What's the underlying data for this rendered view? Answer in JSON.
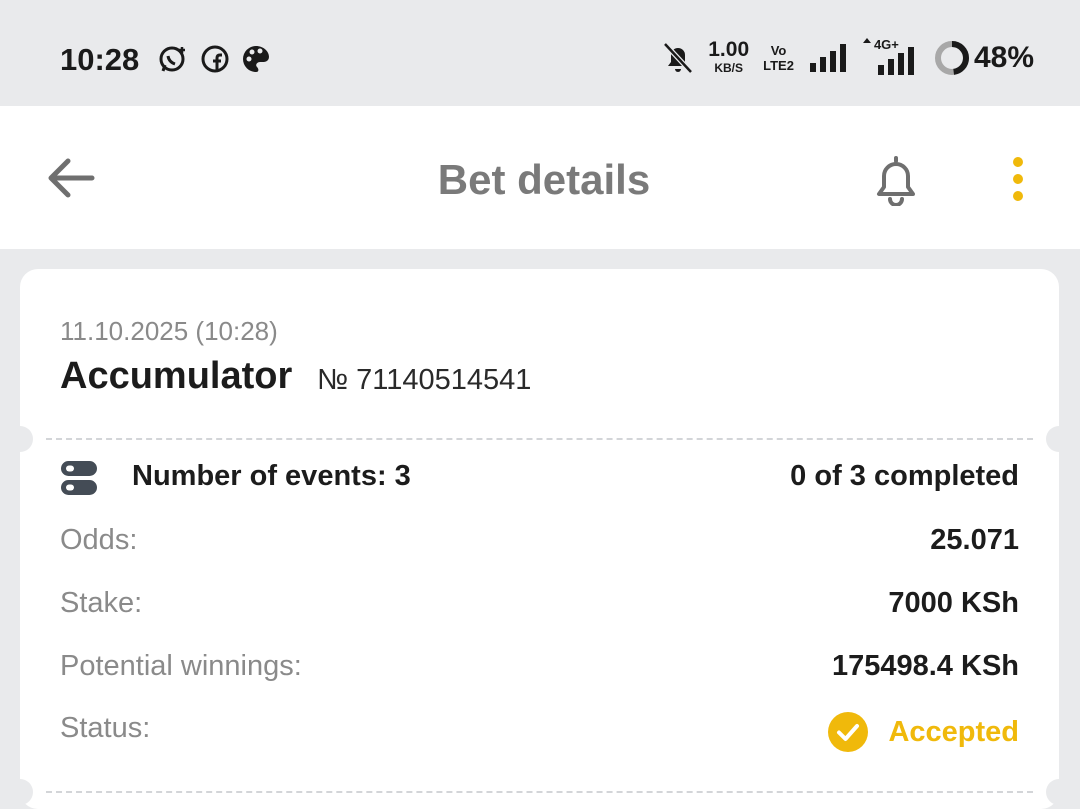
{
  "status_bar": {
    "time": "10:28",
    "apps": [
      "whatsapp-icon",
      "facebook-icon",
      "palette-icon"
    ],
    "net_speed_value": "1.00",
    "net_speed_unit": "KB/S",
    "volte_top": "Vo",
    "volte_bottom": "LTE2",
    "network_type": "4G+",
    "battery_percent": "48%",
    "battery_level": 0.48
  },
  "app_bar": {
    "title": "Bet details"
  },
  "bet": {
    "datetime": "11.10.2025 (10:28)",
    "type": "Accumulator",
    "number": "№ 71140514541",
    "events_label": "Number of events: 3",
    "events_progress": "0 of 3 completed",
    "odds_label": "Odds:",
    "odds_value": "25.071",
    "stake_label": "Stake:",
    "stake_value": "7000 KSh",
    "winnings_label": "Potential winnings:",
    "winnings_value": "175498.4 KSh",
    "status_label": "Status:",
    "status_value": "Accepted"
  },
  "colors": {
    "accent": "#f0b90b",
    "background": "#e9eaec",
    "title_grey": "#7a7a7a"
  }
}
